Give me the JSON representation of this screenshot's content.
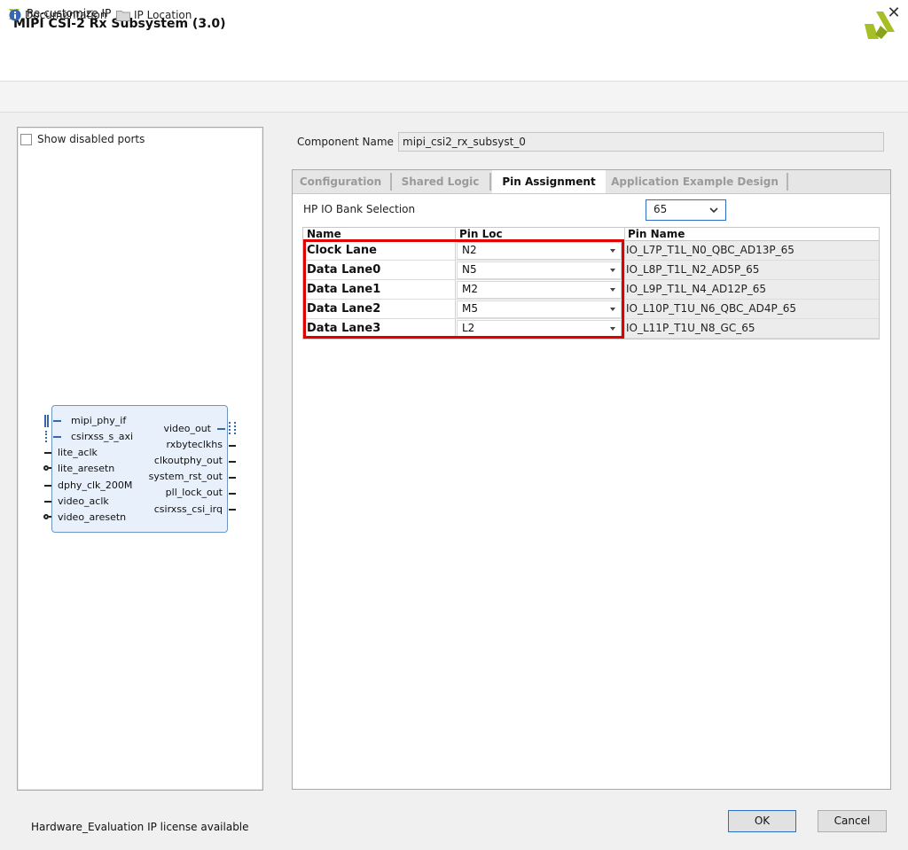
{
  "window": {
    "title": "Re-customize IP",
    "close_glyph": "✕"
  },
  "header": {
    "ip_title": "MIPI CSI-2 Rx Subsystem (3.0)",
    "brand_color": "#a7be26"
  },
  "docbar": {
    "documentation": "Documentation",
    "ip_location": "IP Location"
  },
  "left_panel": {
    "show_disabled_ports": "Show disabled ports",
    "show_disabled_checked": false,
    "block": {
      "left_ports": [
        "mipi_phy_if",
        "csirxss_s_axi",
        "lite_aclk",
        "lite_aresetn",
        "dphy_clk_200M",
        "video_aclk",
        "video_aresetn"
      ],
      "right_ports": [
        "video_out",
        "rxbyteclkhs",
        "clkoutphy_out",
        "system_rst_out",
        "pll_lock_out",
        "csirxss_csi_irq"
      ]
    }
  },
  "component": {
    "label": "Component Name",
    "value": "mipi_csi2_rx_subsyst_0"
  },
  "tabs": [
    {
      "label": "Configuration",
      "active": false
    },
    {
      "label": "Shared Logic",
      "active": false
    },
    {
      "label": "Pin Assignment",
      "active": true
    },
    {
      "label": "Application Example Design",
      "active": false
    }
  ],
  "bank": {
    "label": "HP IO Bank Selection",
    "value": "65"
  },
  "pin_table": {
    "headers": {
      "name": "Name",
      "pin_loc": "Pin Loc",
      "pin_name": "Pin Name"
    },
    "rows": [
      {
        "name": "Clock Lane",
        "pin_loc": "N2",
        "pin_name": "IO_L7P_T1L_N0_QBC_AD13P_65"
      },
      {
        "name": "Data Lane0",
        "pin_loc": "N5",
        "pin_name": "IO_L8P_T1L_N2_AD5P_65"
      },
      {
        "name": "Data Lane1",
        "pin_loc": "M2",
        "pin_name": "IO_L9P_T1L_N4_AD12P_65"
      },
      {
        "name": "Data Lane2",
        "pin_loc": "M5",
        "pin_name": "IO_L10P_T1U_N6_QBC_AD4P_65"
      },
      {
        "name": "Data Lane3",
        "pin_loc": "L2",
        "pin_name": "IO_L11P_T1U_N8_GC_65"
      }
    ]
  },
  "footer": {
    "license": "Hardware_Evaluation IP license available",
    "ok": "OK",
    "cancel": "Cancel"
  },
  "colors": {
    "highlight": "#e00000",
    "focus": "#2b6fc2",
    "ip_block_fill": "#e8f0fb"
  }
}
